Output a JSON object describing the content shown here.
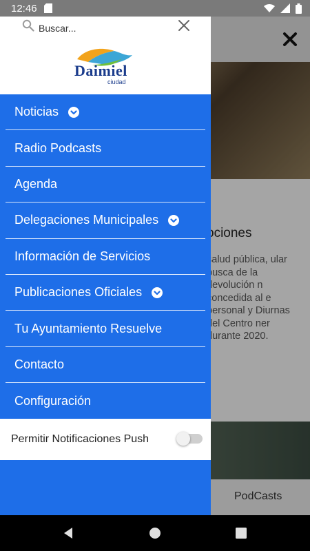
{
  "status_bar": {
    "time": "12:46",
    "icons": [
      "sd-card-icon",
      "wifi-icon",
      "signal-icon",
      "battery-icon"
    ]
  },
  "background": {
    "article_title": "ociones",
    "article_text": "salud pública, ular busca de la devolución n concedida al e personal y Diurnas del Centro ner durante 2020.",
    "tab_label": "PodCasts"
  },
  "drawer": {
    "search": {
      "placeholder": "Buscar...",
      "value": ""
    },
    "logo": {
      "word": "Daimiel",
      "sub": "ciudad"
    },
    "menu": [
      {
        "label": "Noticias",
        "expandable": true
      },
      {
        "label": "Radio Podcasts",
        "expandable": false
      },
      {
        "label": "Agenda",
        "expandable": false
      },
      {
        "label": "Delegaciones Municipales",
        "expandable": true
      },
      {
        "label": "Información de Servicios",
        "expandable": false
      },
      {
        "label": "Publicaciones Oficiales",
        "expandable": true
      },
      {
        "label": "Tu Ayuntamiento Resuelve",
        "expandable": false
      },
      {
        "label": "Contacto",
        "expandable": false
      },
      {
        "label": "Configuración",
        "expandable": false
      }
    ],
    "push_label": "Permitir Notificaciones Push",
    "push_enabled": false
  },
  "colors": {
    "drawer_blue": "#1e6ee8",
    "status_bar": "#7a7a7a"
  }
}
